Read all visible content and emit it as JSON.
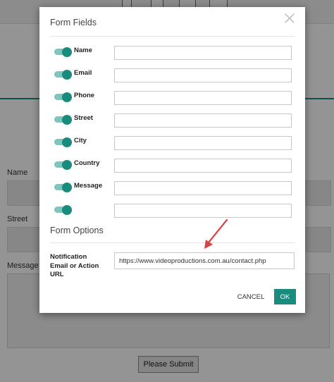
{
  "background": {
    "labels": [
      "Name",
      "Street",
      "Message"
    ],
    "submit_label": "Please Submit"
  },
  "modal": {
    "title": "Form Fields",
    "fields": [
      {
        "label": "Name",
        "enabled": true
      },
      {
        "label": "Email",
        "enabled": true
      },
      {
        "label": "Phone",
        "enabled": true
      },
      {
        "label": "Street",
        "enabled": true
      },
      {
        "label": "City",
        "enabled": true
      },
      {
        "label": "Country",
        "enabled": true
      },
      {
        "label": "Message",
        "enabled": true
      },
      {
        "label": "",
        "enabled": true
      }
    ],
    "options_title": "Form Options",
    "notification_label": "Notification Email or Action URL",
    "notification_value": "https://www.videoproductions.com.au/contact.php",
    "cancel_label": "CANCEL",
    "ok_label": "OK"
  },
  "colors": {
    "accent": "#1a8c7d",
    "toggle_track": "#7dc6bd",
    "arrow": "#d64545"
  }
}
